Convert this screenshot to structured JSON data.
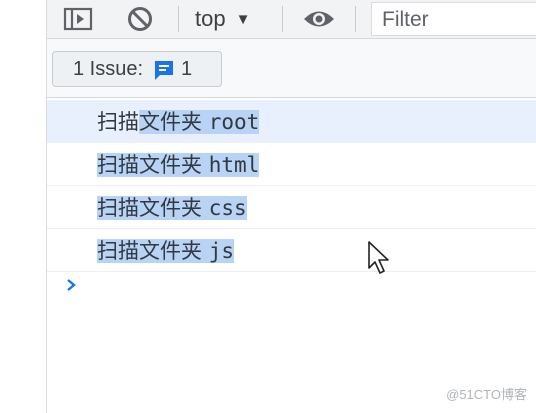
{
  "toolbar": {
    "context_label": "top",
    "filter_placeholder": "Filter"
  },
  "issues": {
    "label": "1 Issue:",
    "count": "1"
  },
  "console": {
    "messages": [
      {
        "prefix": "扫描",
        "selected": "文件夹 root"
      },
      {
        "prefix": "",
        "selected": "扫描文件夹 html"
      },
      {
        "prefix": "",
        "selected": "扫描文件夹 css"
      },
      {
        "prefix": "",
        "selected": "扫描文件夹 js"
      }
    ]
  },
  "watermark": "@51CTO博客",
  "colors": {
    "accent": "#1a73e8",
    "selection": "#b9d3f5"
  }
}
